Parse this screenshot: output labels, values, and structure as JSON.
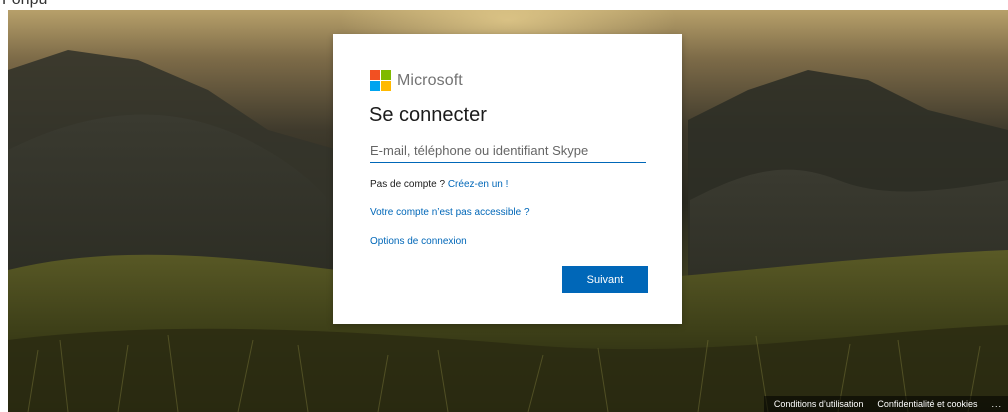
{
  "top_fragment": "Fonpu",
  "brand": {
    "name": "Microsoft"
  },
  "signin": {
    "title": "Se connecter",
    "email_placeholder": "E-mail, téléphone ou identifiant Skype",
    "email_value": "",
    "no_account_text": "Pas de compte ?",
    "create_link": "Créez-en un !",
    "inaccessible_link": "Votre compte n’est pas accessible ?",
    "signin_options_link": "Options de connexion",
    "next_button": "Suivant"
  },
  "footer": {
    "terms": "Conditions d’utilisation",
    "privacy": "Confidentialité et cookies",
    "more": "..."
  },
  "colors": {
    "accent": "#0067b8",
    "logo_red": "#f25022",
    "logo_green": "#7fba00",
    "logo_blue": "#00a4ef",
    "logo_yellow": "#ffb900"
  },
  "icons": {
    "logo": "microsoft-logo-icon",
    "more": "ellipsis-icon"
  }
}
